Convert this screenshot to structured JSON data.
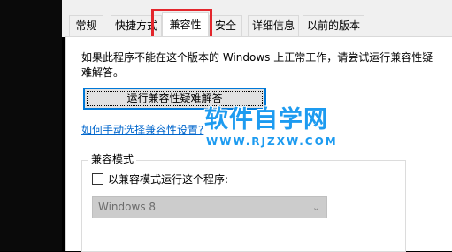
{
  "tabs": [
    {
      "label": "常规",
      "active": false
    },
    {
      "label": "快捷方式",
      "active": false
    },
    {
      "label": "兼容性",
      "active": true
    },
    {
      "label": "安全",
      "active": false
    },
    {
      "label": "详细信息",
      "active": false
    },
    {
      "label": "以前的版本",
      "active": false
    }
  ],
  "highlight_color": "#e3262c",
  "compat": {
    "description": "如果此程序不能在这个版本的 Windows 上正常工作，请尝试运行兼容性疑难解答。",
    "troubleshoot_button": "运行兼容性疑难解答",
    "manual_link": "如何手动选择兼容性设置?",
    "group_title": "兼容模式",
    "checkbox_label": "以兼容模式运行这个程序:",
    "checkbox_checked": false,
    "os_selected": "Windows 8"
  },
  "watermark": {
    "title": "软件自学网",
    "url": "WWW.RJZXW.COM",
    "color": "#1d9bf0"
  }
}
